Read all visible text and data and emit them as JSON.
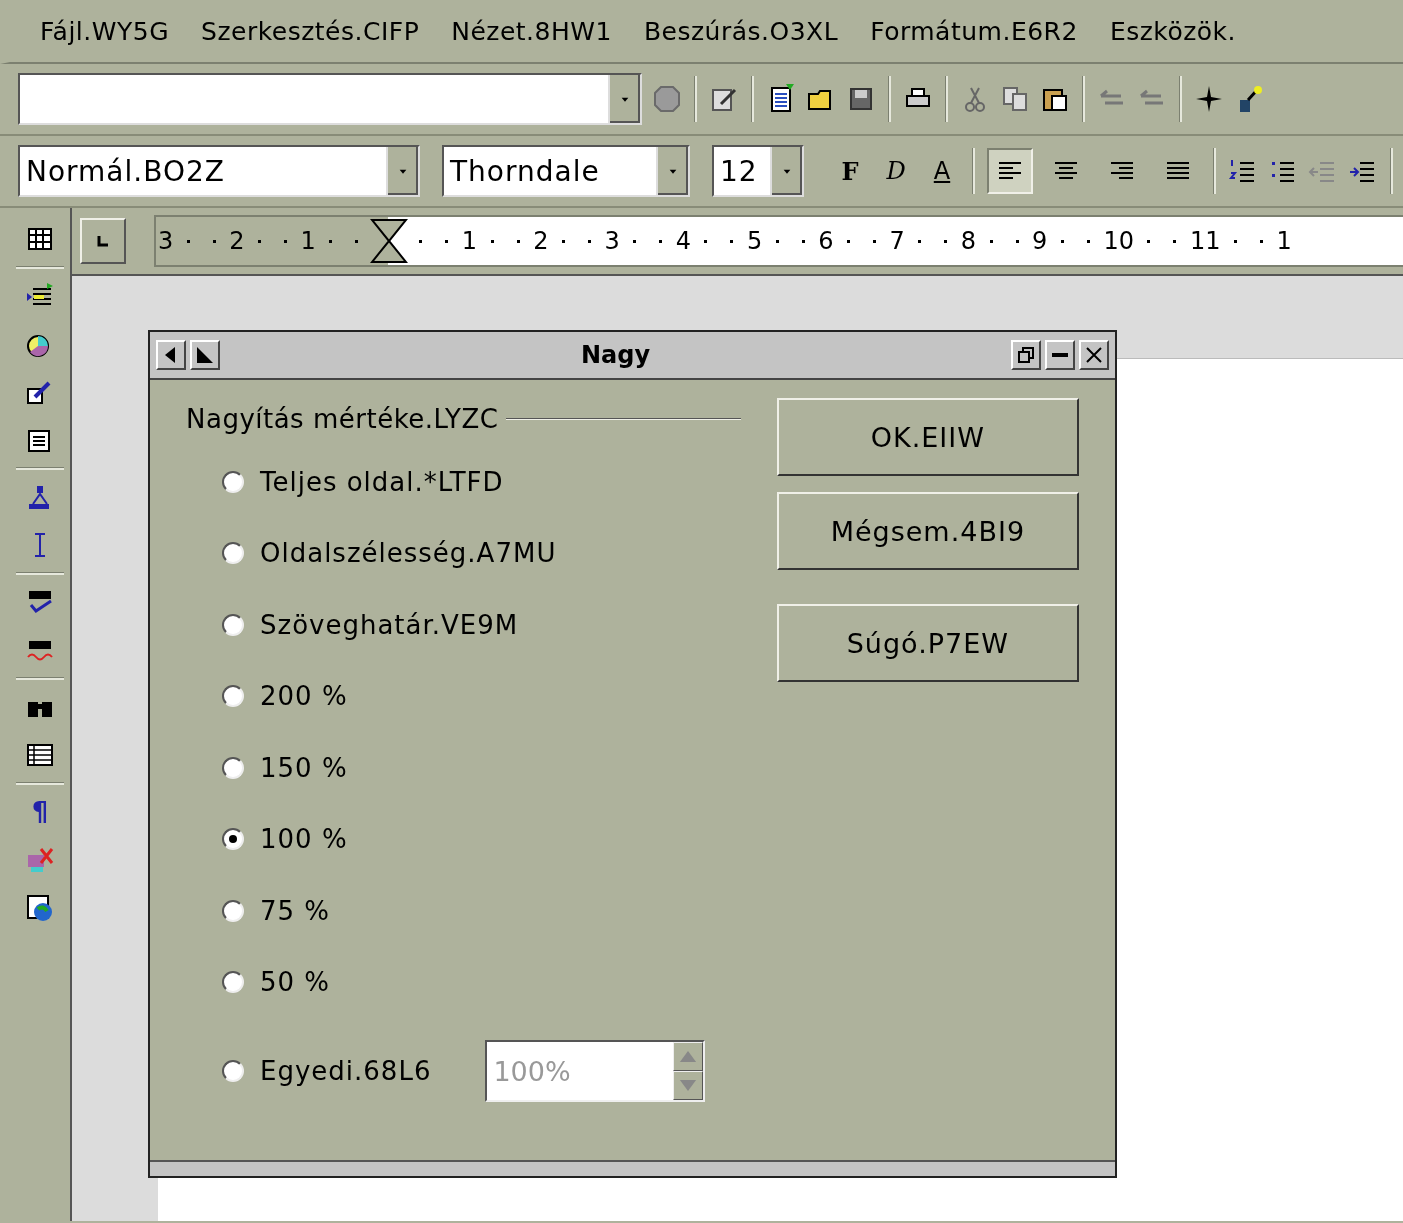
{
  "menu_bar": {
    "items": [
      "Fájl.WY5G",
      "Szerkesztés.CIFP",
      "Nézet.8HW1",
      "Beszúrás.O3XL",
      "Formátum.E6R2",
      "Eszközök."
    ]
  },
  "object_bar": {
    "style": "Normál.BO2Z",
    "font": "Thorndale",
    "size": "12",
    "format_buttons": [
      {
        "label": "F",
        "kind": "bold"
      },
      {
        "label": "D",
        "kind": "italic"
      },
      {
        "label": "A",
        "kind": "underline"
      }
    ],
    "align_buttons": [
      {
        "kind": "left",
        "selected": true
      },
      {
        "kind": "center",
        "selected": false
      },
      {
        "kind": "right",
        "selected": false
      },
      {
        "kind": "justify",
        "selected": false
      }
    ]
  },
  "ruler": {
    "left_labels": [
      "3",
      "2",
      "1"
    ],
    "right_labels": [
      "1",
      "2",
      "3",
      "4",
      "5",
      "6",
      "7",
      "8",
      "9",
      "10",
      "11",
      "1"
    ]
  },
  "main_toolbar": {
    "pilcrow": "¶"
  },
  "dialog": {
    "title": "Nagy",
    "group_label": "Nagyítás mértéke.LYZC",
    "options": [
      {
        "label": "Teljes oldal.*LTFD",
        "selected": false
      },
      {
        "label": "Oldalszélesség.A7MU",
        "selected": false
      },
      {
        "label": "Szöveghatár.VE9M",
        "selected": false
      },
      {
        "label": "200 %",
        "selected": false
      },
      {
        "label": "150 %",
        "selected": false
      },
      {
        "label": "100 %",
        "selected": true
      },
      {
        "label": "75 %",
        "selected": false
      },
      {
        "label": "50 %",
        "selected": false
      },
      {
        "label": "Egyedi.68L6",
        "selected": false
      }
    ],
    "custom_field": {
      "value": "100%",
      "disabled": true
    },
    "buttons": [
      "OK.EIIW",
      "Mégsem.4BI9",
      "Súgó.P7EW"
    ]
  }
}
